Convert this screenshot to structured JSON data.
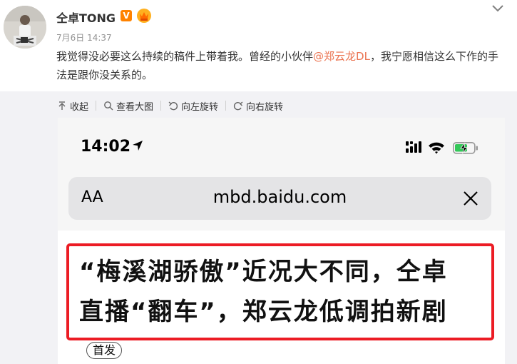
{
  "post": {
    "user_name": "仝卓TONG",
    "vip_badge": "V",
    "time": "7月6日 14:37",
    "text_before": "我觉得没必要这么持续的稿件上带着我。曾经的小伙伴",
    "mention": "@郑云龙DL",
    "text_after": "，我宁愿相信这么下作的手法是跟你没关系的。"
  },
  "toolbar": {
    "collapse": "收起",
    "view_large": "查看大图",
    "rotate_left": "向左旋转",
    "rotate_right": "向右旋转"
  },
  "screenshot": {
    "status_time": "14:02",
    "reader_aa": "AA",
    "url": "mbd.baidu.com",
    "headline_line1": "“梅溪湖骄傲”近况大不同，仝卓",
    "headline_line2": "直播“翻车”，郑云龙低调拍新剧",
    "first_pub": "首发"
  },
  "colors": {
    "mention": "#eb7350",
    "vip_orange": "#ff8200",
    "headline_border": "#ec1c24",
    "battery_green": "#34c759"
  },
  "icons": {
    "dropdown": "chevron-down-icon",
    "collapse": "collapse-up-icon",
    "view_large": "search-icon",
    "rotate_left": "rotate-left-icon",
    "rotate_right": "rotate-right-icon",
    "location": "location-arrow-icon",
    "signal": "signal-icon",
    "wifi": "wifi-icon",
    "battery": "battery-charging-icon",
    "clear": "close-icon"
  }
}
